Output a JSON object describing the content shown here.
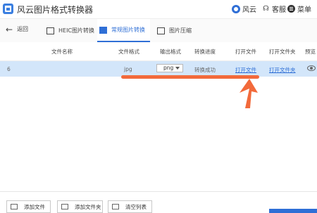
{
  "app": {
    "title": "风云图片格式转换器"
  },
  "titlebar": {
    "fengyun": "风云",
    "kefu": "客服",
    "menu": "菜单"
  },
  "nav": {
    "back": "返回",
    "tabs": [
      {
        "label": "HEIC图片转换",
        "icon": "heic-image-icon",
        "active": false
      },
      {
        "label": "常规图片转换",
        "icon": "image-convert-icon",
        "active": true
      },
      {
        "label": "图片压缩",
        "icon": "image-compress-icon",
        "active": false
      }
    ]
  },
  "table": {
    "headers": [
      "文件名称",
      "文件格式",
      "输出格式",
      "转换进度",
      "打开文件",
      "打开文件夹",
      "预览"
    ],
    "rows": [
      {
        "index": "6",
        "format": "jpg",
        "output": "png",
        "progress": "转换成功",
        "open_file": "打开文件",
        "open_folder": "打开文件夹"
      }
    ]
  },
  "footer": {
    "add_file": "添加文件",
    "add_folder": "添加文件夹",
    "clear_list": "清空列表"
  },
  "colors": {
    "accent": "#2f6fd6",
    "selected_row": "#d3e6fa",
    "annotation": "#f26a3b"
  }
}
